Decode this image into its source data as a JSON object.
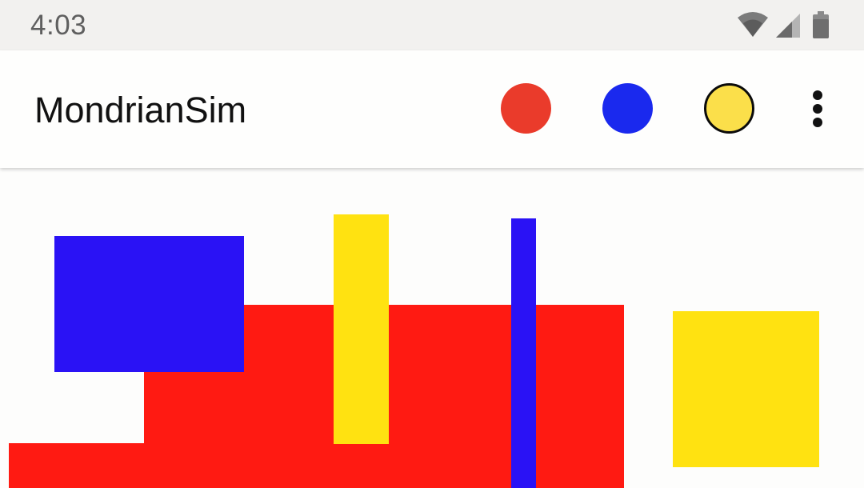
{
  "status_bar": {
    "time": "4:03",
    "icons": [
      "wifi-icon",
      "cell-signal-icon",
      "battery-icon"
    ]
  },
  "app_bar": {
    "title": "MondrianSim",
    "color_buttons": [
      {
        "name": "red",
        "color": "#ea3b2b"
      },
      {
        "name": "blue",
        "color": "#1a29ee"
      },
      {
        "name": "yellow",
        "color": "#fbdf4a",
        "selected": true
      }
    ],
    "overflow_icon": "more-vert-icon"
  },
  "canvas": {
    "palette": {
      "red": "#ff1a12",
      "blue": "#2a12f5",
      "yellow": "#ffe211",
      "background": "#fdfdfc"
    }
  }
}
